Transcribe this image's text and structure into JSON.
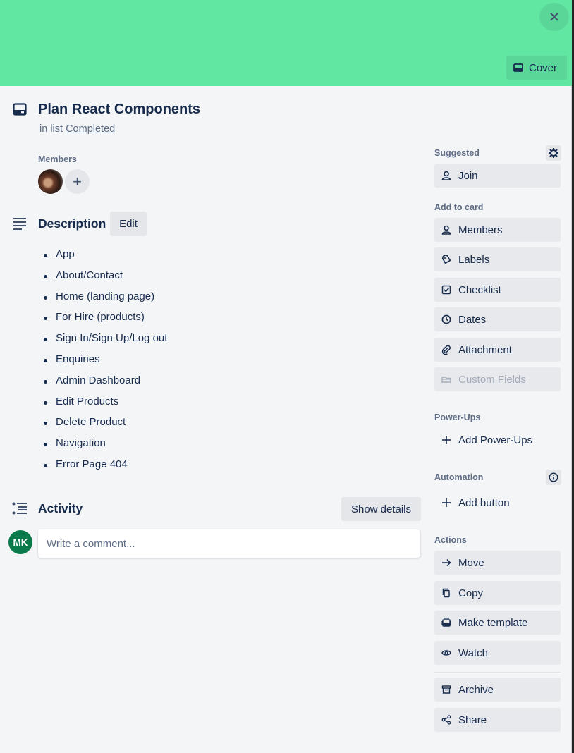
{
  "card": {
    "title": "Plan React Components",
    "list_prefix": "in list",
    "list_name": "Completed",
    "cover_color": "#61e7a1"
  },
  "header": {
    "close_symbol": "✕",
    "cover_label": "Cover"
  },
  "members": {
    "label": "Members",
    "add_symbol": "+"
  },
  "description": {
    "title": "Description",
    "edit_label": "Edit",
    "items": [
      "App",
      "About/Contact",
      "Home (landing page)",
      "For Hire (products)",
      "Sign In/Sign Up/Log out",
      "Enquiries",
      "Admin Dashboard",
      "Edit Products",
      "Delete Product",
      "Navigation",
      "Error Page 404"
    ]
  },
  "activity": {
    "title": "Activity",
    "show_details_label": "Show details",
    "user_initials": "MK",
    "user_color": "#0b7a4b",
    "comment_placeholder": "Write a comment..."
  },
  "sidebar": {
    "suggested_label": "Suggested",
    "join_label": "Join",
    "add_to_card_label": "Add to card",
    "add_to_card": [
      {
        "label": "Members",
        "icon": "person-icon"
      },
      {
        "label": "Labels",
        "icon": "tag-icon"
      },
      {
        "label": "Checklist",
        "icon": "checklist-icon"
      },
      {
        "label": "Dates",
        "icon": "clock-icon"
      },
      {
        "label": "Attachment",
        "icon": "paperclip-icon"
      },
      {
        "label": "Custom Fields",
        "icon": "custom-fields-icon"
      }
    ],
    "powerups_label": "Power-Ups",
    "add_powerups_label": "Add Power-Ups",
    "automation_label": "Automation",
    "add_button_label": "Add button",
    "actions_label": "Actions",
    "actions": [
      {
        "label": "Move",
        "icon": "arrow-right-icon"
      },
      {
        "label": "Copy",
        "icon": "copy-icon"
      },
      {
        "label": "Make template",
        "icon": "template-icon"
      },
      {
        "label": "Watch",
        "icon": "eye-icon"
      },
      {
        "label": "Archive",
        "icon": "archive-icon"
      },
      {
        "label": "Share",
        "icon": "share-icon"
      }
    ]
  }
}
